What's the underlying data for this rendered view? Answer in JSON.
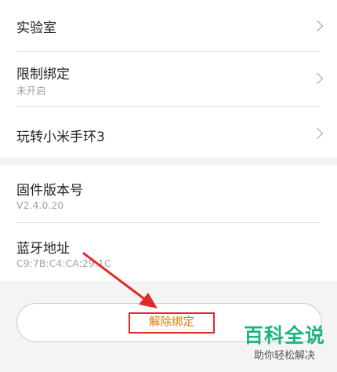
{
  "settings": {
    "lab": {
      "label": "实验室"
    },
    "restricted_binding": {
      "label": "限制绑定",
      "status": "未开启"
    },
    "play_band": {
      "label": "玩转小米手环3"
    }
  },
  "info": {
    "firmware": {
      "label": "固件版本号",
      "value": "V2.4.0.20"
    },
    "bluetooth": {
      "label": "蓝牙地址",
      "value": "C9:7B:C4:CA:29:1C"
    }
  },
  "actions": {
    "unbind_label": "解除绑定"
  },
  "annotation": {
    "highlight_color": "#e12a2a"
  },
  "watermark": {
    "brand": "百科全说",
    "slogan": "助你轻松解决"
  }
}
